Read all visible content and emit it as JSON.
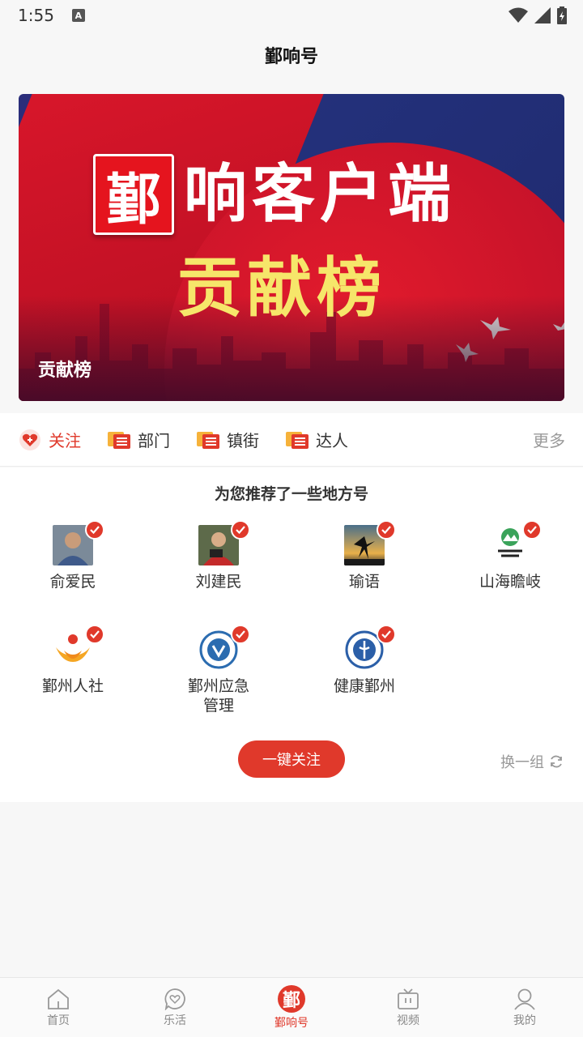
{
  "status": {
    "time": "1:55",
    "notif_letter": "A"
  },
  "header": {
    "title": "鄞响号"
  },
  "banner": {
    "logo_char": "鄞",
    "title_main": "响客户端",
    "title_sub": "贡献榜",
    "caption": "贡献榜"
  },
  "tabs": [
    {
      "label": "关注",
      "icon": "heart-icon",
      "active": true
    },
    {
      "label": "部门",
      "icon": "list-icon"
    },
    {
      "label": "镇街",
      "icon": "list-icon"
    },
    {
      "label": "达人",
      "icon": "list-icon"
    }
  ],
  "tabs_more": "更多",
  "recommend": {
    "title": "为您推荐了一些地方号",
    "accounts": [
      {
        "name": "俞爱民"
      },
      {
        "name": "刘建民"
      },
      {
        "name": "瑜语"
      },
      {
        "name": "山海瞻岐"
      },
      {
        "name": "鄞州人社"
      },
      {
        "name": "鄞州应急管理"
      },
      {
        "name": "健康鄞州"
      }
    ],
    "follow_all": "一键关注",
    "swap": "换一组"
  },
  "bottom_nav": [
    {
      "label": "首页",
      "icon": "home-icon"
    },
    {
      "label": "乐活",
      "icon": "heart-chat-icon"
    },
    {
      "label": "鄞响号",
      "icon": "yin-logo-icon",
      "active": true,
      "logo_char": "鄞"
    },
    {
      "label": "视频",
      "icon": "tv-icon"
    },
    {
      "label": "我的",
      "icon": "user-icon"
    }
  ],
  "colors": {
    "accent": "#e0392b",
    "banner_yellow": "#f6e66a"
  }
}
